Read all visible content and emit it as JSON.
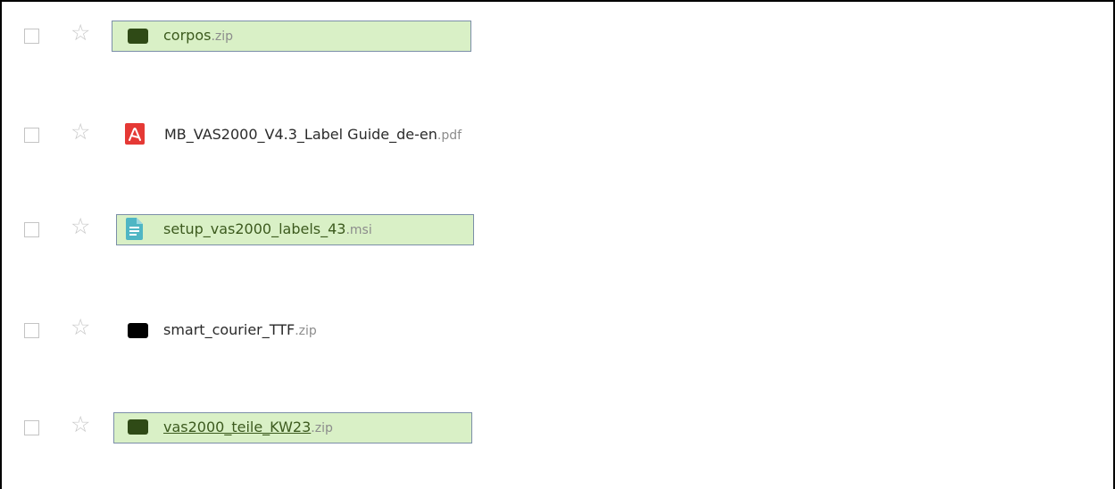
{
  "files": [
    {
      "name": "corpos",
      "ext": ".zip",
      "icon": "zip-icon",
      "highlighted": true,
      "starred": false,
      "checked": false
    },
    {
      "name": "MB_VAS2000_V4.3_Label Guide_de-en",
      "ext": ".pdf",
      "icon": "pdf-icon",
      "highlighted": false,
      "starred": false,
      "checked": false
    },
    {
      "name": "setup_vas2000_labels_43",
      "ext": ".msi",
      "icon": "document-icon",
      "highlighted": true,
      "starred": false,
      "checked": false
    },
    {
      "name": "smart_courier_TTF",
      "ext": ".zip",
      "icon": "zip-icon",
      "highlighted": false,
      "starred": false,
      "checked": false
    },
    {
      "name": "vas2000_teile_KW23",
      "ext": ".zip",
      "icon": "zip-icon",
      "highlighted": true,
      "starred": false,
      "checked": false
    }
  ],
  "icons": {
    "star": "☆"
  },
  "colors": {
    "highlight_bg": "#d9f0c6",
    "highlight_border": "#7b8ea8",
    "highlight_text": "#3c5a1e",
    "zip_green": "#2f4a16",
    "pdf_red": "#e53935",
    "msi_teal": "#4fb6c4"
  }
}
